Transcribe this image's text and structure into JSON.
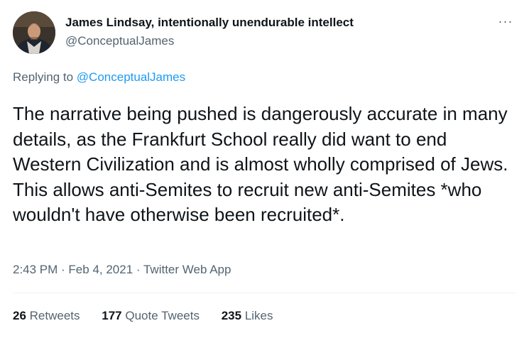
{
  "author": {
    "display_name": "James Lindsay, intentionally unendurable intellect",
    "handle": "@ConceptualJames",
    "avatar_icon": "profile-photo"
  },
  "more_icon": "ellipsis-icon",
  "more_label": "···",
  "reply": {
    "prefix": "Replying to",
    "target": "@ConceptualJames"
  },
  "tweet": {
    "text": "The narrative being pushed is dangerously accurate in many details, as the Frankfurt School really did want to end Western Civilization and is almost wholly comprised of Jews. This allows anti-Semites to recruit new anti-Semites *who wouldn't have otherwise been recruited*."
  },
  "meta": {
    "time": "2:43 PM",
    "separator": " · ",
    "date": "Feb 4, 2021",
    "source": "Twitter Web App"
  },
  "stats": {
    "retweets_count": "26",
    "retweets_label": "Retweets",
    "quote_count": "177",
    "quote_label": "Quote Tweets",
    "likes_count": "235",
    "likes_label": "Likes"
  },
  "colors": {
    "accent": "#1d9bf0",
    "text": "#0f1419",
    "secondary": "#536471",
    "divider": "#eff3f4"
  }
}
